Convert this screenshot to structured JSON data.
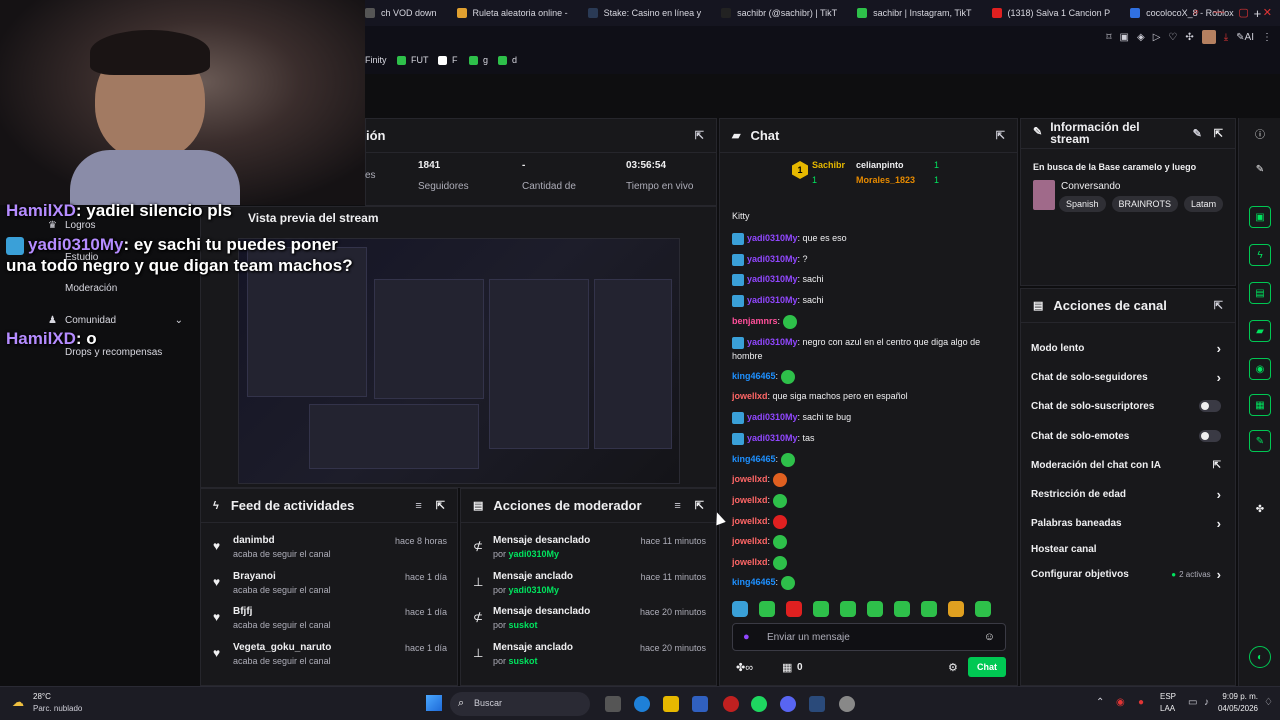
{
  "browser": {
    "tabs": [
      {
        "label": "ch VOD down",
        "color": "#555"
      },
      {
        "label": "Ruleta aleatoria online -",
        "color": "#e0a030"
      },
      {
        "label": "Stake: Casino en línea y",
        "color": "#2a3a55"
      },
      {
        "label": "sachibr (@sachibr) | TikT",
        "color": "#222"
      },
      {
        "label": "sachibr | Instagram, TikT",
        "color": "#2ec04a"
      },
      {
        "label": "(1318) Salva 1 Cancion P",
        "color": "#e02020"
      },
      {
        "label": "cocolocoX_8 - Roblox",
        "color": "#3070e0"
      }
    ],
    "new_tab": "+",
    "bookmarks": [
      {
        "label": "Finity",
        "color": "#000"
      },
      {
        "label": "FUT",
        "color": "#2ec04a"
      },
      {
        "label": "F",
        "color": "#fff"
      },
      {
        "label": "g",
        "color": "#2ec04a"
      },
      {
        "label": "d",
        "color": "#2ec04a"
      }
    ]
  },
  "overlay": {
    "line1_user": "HamilXD",
    "line1_text": ": yadiel silencio pls",
    "line2_user": "yadi0310My",
    "line2_text": ": ey sachi tu puedes poner una todo negro y que digan team machos?",
    "line3_user": "HamilXD",
    "line3_text": ": o"
  },
  "sidenav": {
    "logros": "Logros",
    "estudio": "Estudio",
    "moderacion": "Moderación",
    "comunidad": "Comunidad",
    "drops": "Drops y recompensas"
  },
  "session": {
    "title_fragment": "ión",
    "stats": [
      {
        "value": "",
        "label": "es"
      },
      {
        "value": "1841",
        "label": "Seguidores"
      },
      {
        "value": "-",
        "label": "Cantidad de"
      },
      {
        "value": "03:56:54",
        "label": "Tiempo en vivo"
      }
    ]
  },
  "preview": {
    "title": "Vista previa del stream"
  },
  "feed": {
    "title": "Feed de actividades",
    "items": [
      {
        "name": "danimbd",
        "sub": "acaba de seguir el canal",
        "time": "hace 8 horas"
      },
      {
        "name": "Brayanoi",
        "sub": "acaba de seguir el canal",
        "time": "hace 1 día"
      },
      {
        "name": "Bfjfj",
        "sub": "acaba de seguir el canal",
        "time": "hace 1 día"
      },
      {
        "name": "Vegeta_goku_naruto",
        "sub": "acaba de seguir el canal",
        "time": "hace 1 día"
      }
    ]
  },
  "modactions": {
    "title": "Acciones de moderador",
    "items": [
      {
        "action": "Mensaje desanclado",
        "by": "por",
        "user": "yadi0310My",
        "time": "hace 11 minutos"
      },
      {
        "action": "Mensaje anclado",
        "by": "por",
        "user": "yadi0310My",
        "time": "hace 11 minutos"
      },
      {
        "action": "Mensaje desanclado",
        "by": "por",
        "user": "suskot",
        "time": "hace 20 minutos"
      },
      {
        "action": "Mensaje anclado",
        "by": "por",
        "user": "suskot",
        "time": "hace 20 minutos"
      }
    ]
  },
  "chat": {
    "title": "Chat",
    "top1_user": "Sachibr",
    "top1_count": "1",
    "top2_user": "celianpinto",
    "top2_count": "1",
    "top3_user": "Morales_1823",
    "top3_count": "1",
    "rank": "1",
    "partial": "Kitty",
    "messages": [
      {
        "user": "yadi0310My",
        "cls": "u1",
        "badge": true,
        "text": ": que es eso"
      },
      {
        "user": "yadi0310My",
        "cls": "u1",
        "badge": true,
        "text": ": ?"
      },
      {
        "user": "yadi0310My",
        "cls": "u1",
        "badge": true,
        "text": ": sachi"
      },
      {
        "user": "yadi0310My",
        "cls": "u1",
        "badge": true,
        "text": ": sachi"
      },
      {
        "user": "benjamnrs",
        "cls": "u3",
        "badge": false,
        "text": ":"
      },
      {
        "user": "yadi0310My",
        "cls": "u1",
        "badge": true,
        "text": ": negro con azul en el centro que diga algo de hombre"
      },
      {
        "user": "king46465",
        "cls": "u2",
        "badge": false,
        "text": ":"
      },
      {
        "user": "jowellxd",
        "cls": "u4",
        "badge": false,
        "text": ": que siga machos pero en español"
      },
      {
        "user": "yadi0310My",
        "cls": "u1",
        "badge": true,
        "text": ": sachi te bug"
      },
      {
        "user": "yadi0310My",
        "cls": "u1",
        "badge": true,
        "text": ": tas"
      },
      {
        "user": "king46465",
        "cls": "u2",
        "badge": false,
        "text": ":"
      },
      {
        "user": "jowellxd",
        "cls": "u4",
        "badge": false,
        "text": ":"
      },
      {
        "user": "jowellxd",
        "cls": "u4",
        "badge": false,
        "text": ":"
      },
      {
        "user": "jowellxd",
        "cls": "u4",
        "badge": false,
        "text": ":"
      },
      {
        "user": "jowellxd",
        "cls": "u4",
        "badge": false,
        "text": ":"
      },
      {
        "user": "jowellxd",
        "cls": "u4",
        "badge": false,
        "text": ":"
      },
      {
        "user": "king46465",
        "cls": "u2",
        "badge": false,
        "text": ":"
      }
    ],
    "input_placeholder": "Enviar un mensaje",
    "points": "0",
    "send_label": "Chat"
  },
  "streaminfo": {
    "title": "Información del stream",
    "stream_title": "En busca de la Base caramelo y luego",
    "category": "Conversando",
    "tags": [
      "Spanish",
      "BRAINROTS",
      "Latam"
    ]
  },
  "channel": {
    "title": "Acciones de canal",
    "actions": [
      {
        "label": "Modo lento",
        "ctl": "chev"
      },
      {
        "label": "Chat de solo-seguidores",
        "ctl": "chev"
      },
      {
        "label": "Chat de solo-suscriptores",
        "ctl": "toggle"
      },
      {
        "label": "Chat de solo-emotes",
        "ctl": "toggle"
      },
      {
        "label": "Moderación del chat con IA",
        "ctl": "ext"
      },
      {
        "label": "Restricción de edad",
        "ctl": "chev"
      },
      {
        "label": "Palabras baneadas",
        "ctl": "chev"
      },
      {
        "label": "Hostear canal",
        "ctl": "none"
      },
      {
        "label": "Configurar objetivos",
        "ctl": "chev"
      }
    ],
    "goals_active": "2 activas"
  },
  "taskbar": {
    "weather_temp": "28°C",
    "weather_desc": "Parc. nublado",
    "search": "Buscar",
    "lang": "ESP",
    "region": "LAA",
    "time": "9:09 p. m.",
    "date": "04/05/2026"
  },
  "colors": {
    "accent": "#00e45e",
    "purple": "#9147ff",
    "bg": "#0e0e10",
    "panel": "#18181b"
  }
}
